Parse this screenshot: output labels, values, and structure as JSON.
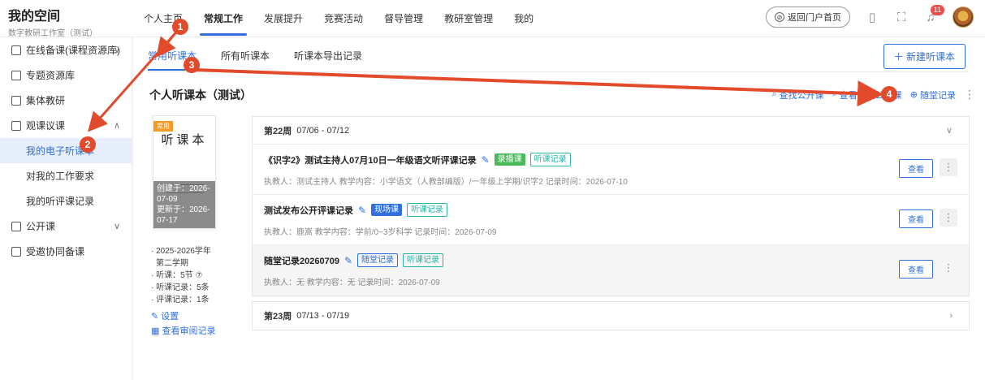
{
  "brand": {
    "title": "我的空间",
    "subtitle": "数字教研工作室（测试）"
  },
  "nav": {
    "items": [
      {
        "label": "个人主页",
        "active": false
      },
      {
        "label": "常规工作",
        "active": true
      },
      {
        "label": "发展提升",
        "active": false
      },
      {
        "label": "竞赛活动",
        "active": false
      },
      {
        "label": "督导管理",
        "active": false
      },
      {
        "label": "教研室管理",
        "active": false
      },
      {
        "label": "我的",
        "active": false
      }
    ]
  },
  "topright": {
    "portal_label": "返回门户首页",
    "bell_count": "11"
  },
  "sidebar": {
    "items": [
      {
        "label": "在线备课(课程资源库)",
        "caret": "∨"
      },
      {
        "label": "专题资源库",
        "caret": ""
      },
      {
        "label": "集体教研",
        "caret": ""
      },
      {
        "label": "观课议课",
        "caret": "∧"
      },
      {
        "label": "公开课",
        "caret": "∨"
      },
      {
        "label": "受邀协同备课",
        "caret": ""
      }
    ],
    "subitems": [
      {
        "label": "我的电子听课本",
        "active": true
      },
      {
        "label": "对我的工作要求",
        "active": false
      },
      {
        "label": "我的听评课记录",
        "active": false
      }
    ]
  },
  "tabs": [
    {
      "label": "常用听课本",
      "active": true
    },
    {
      "label": "所有听课本",
      "active": false
    },
    {
      "label": "听课本导出记录",
      "active": false
    }
  ],
  "new_button": "＋ 新建听课本",
  "page_title": "个人听课本（测试）",
  "actions": {
    "find_public": "查找公开课",
    "view_assigned": "查看受邀公开课",
    "add_record": "随堂记录"
  },
  "cover": {
    "badge": "常用",
    "title": "听课本",
    "created": "创建于：2026-07-09",
    "updated": "更新于：2026-07-17"
  },
  "meta": {
    "year": "· 2025-2026学年",
    "term": "第二学期",
    "lessons": "· 听课：5节",
    "listen_records": "· 听课记录：5条",
    "review_records": "· 评课记录：1条",
    "settings": "设置",
    "audit": "查看审阅记录"
  },
  "weeks": [
    {
      "label": "第22周",
      "range": "07/06 - 07/12",
      "expanded": true,
      "records": [
        {
          "title": "《识字2》测试主持人07月10日一年级语文听评课记录",
          "tags": [
            {
              "text": "录播课",
              "style": "green-fill"
            },
            {
              "text": "听课记录",
              "style": "teal-out"
            }
          ],
          "info": "执教人：测试主持人    教学内容：小学语文（人教部编版）/一年级上学期/识字2    记录时间：2026-07-10"
        },
        {
          "title": "测试发布公开评课记录",
          "tags": [
            {
              "text": "现场课",
              "style": "blue-fill"
            },
            {
              "text": "听课记录",
              "style": "teal-out"
            }
          ],
          "info": "执教人：鹿嵩    教学内容：学前/0~3岁科学    记录时间：2026-07-09"
        },
        {
          "title": "随堂记录20260709",
          "tags": [
            {
              "text": "随堂记录",
              "style": "blue-out"
            },
            {
              "text": "听课记录",
              "style": "teal-out"
            }
          ],
          "info": "执教人：无    教学内容：无    记录时间：2026-07-09"
        }
      ]
    },
    {
      "label": "第23周",
      "range": "07/13 - 07/19",
      "expanded": false,
      "records": []
    }
  ],
  "view_label": "查看",
  "annotation_steps": [
    "1",
    "2",
    "3",
    "4"
  ],
  "colors": {
    "accent": "#2f6fde",
    "annotation": "#e24a2c",
    "badge": "#f59a23"
  }
}
